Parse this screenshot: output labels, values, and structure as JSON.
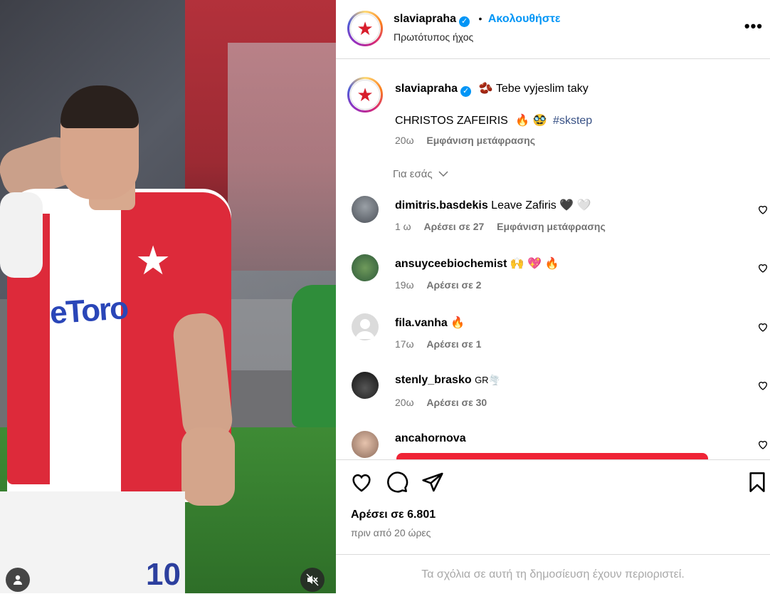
{
  "header": {
    "username": "slaviapraha",
    "follow_label": "Ακολουθήστε",
    "separator": "•",
    "audio": "Πρωτότυπος ήχος"
  },
  "caption": {
    "username": "slaviapraha",
    "emoji1": "🫘",
    "line1": "Tebe vyjeslim taky",
    "line2_text": "CHRISTOS ZAFEIRIS",
    "line2_emojis": "🔥 🥸",
    "hashtag": "#skstep",
    "time": "20ω",
    "translate": "Εμφάνιση μετάφρασης"
  },
  "for_you_label": "Για εσάς",
  "comments": [
    {
      "user": "dimitris.basdekis",
      "text": "Leave Zafiris 🖤 🤍",
      "time": "1 ω",
      "likes": "Αρέσει σε 27",
      "translate": "Εμφάνιση μετάφρασης"
    },
    {
      "user": "ansuyceebiochemist",
      "text": "🙌 💖 🔥",
      "time": "19ω",
      "likes": "Αρέσει σε 2"
    },
    {
      "user": "fila.vanha",
      "text": "🔥",
      "time": "17ω",
      "likes": "Αρέσει σε 1"
    },
    {
      "user": "stenly_brasko",
      "text": "GR🌪️",
      "time": "20ω",
      "likes": "Αρέσει σε 30"
    },
    {
      "user": "ancahornova",
      "text": ""
    }
  ],
  "likes_count": "Αρέσει σε 6.801",
  "posted_ago": "πριν από 20 ώρες",
  "restricted_note": "Τα σχόλια σε αυτή τη δημοσίευση έχουν περιοριστεί.",
  "media": {
    "sponsor_text": "eToro",
    "shirt_number": "10"
  },
  "colors": {
    "accent": "#0095f6",
    "slavia_red": "#d81e2c"
  }
}
